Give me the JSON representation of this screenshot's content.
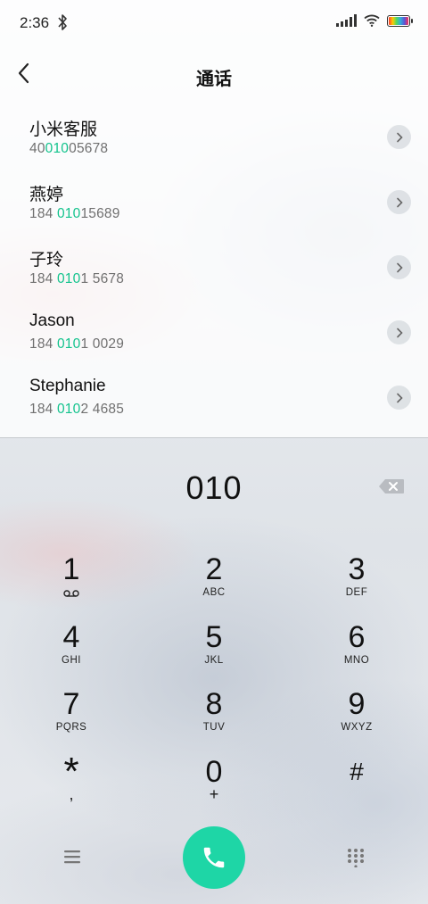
{
  "status": {
    "time": "2:36"
  },
  "header": {
    "title": "通话"
  },
  "contacts": [
    {
      "name": "小米客服",
      "num_pre": "40",
      "num_hl": "010",
      "num_post": "05678"
    },
    {
      "name": "燕婷",
      "num_pre": "184 ",
      "num_hl": "010",
      "num_post": "15689"
    },
    {
      "name": "子玲",
      "num_pre": "184 ",
      "num_hl": "010",
      "num_post": "1 5678"
    },
    {
      "name": "Jason",
      "num_pre": "184 ",
      "num_hl": "010",
      "num_post": "1 0029"
    },
    {
      "name": "Stephanie",
      "num_pre": "184 ",
      "num_hl": "010",
      "num_post": "2 4685"
    }
  ],
  "dialer": {
    "number": "010"
  },
  "keypad": [
    {
      "digit": "1",
      "letters": ""
    },
    {
      "digit": "2",
      "letters": "ABC"
    },
    {
      "digit": "3",
      "letters": "DEF"
    },
    {
      "digit": "4",
      "letters": "GHI"
    },
    {
      "digit": "5",
      "letters": "JKL"
    },
    {
      "digit": "6",
      "letters": "MNO"
    },
    {
      "digit": "7",
      "letters": "PQRS"
    },
    {
      "digit": "8",
      "letters": "TUV"
    },
    {
      "digit": "9",
      "letters": "WXYZ"
    },
    {
      "digit": "*",
      "letters": ","
    },
    {
      "digit": "0",
      "letters": "+"
    },
    {
      "digit": "#",
      "letters": ""
    }
  ],
  "colors": {
    "highlight": "#13c38d",
    "call_button": "#1ed6a6"
  },
  "icons": {
    "back": "chevron-left-icon",
    "arrow": "chevron-right-icon",
    "backspace": "backspace-icon",
    "voicemail": "voicemail-icon",
    "menu": "menu-icon",
    "call": "phone-icon",
    "keypad_toggle": "dialpad-icon"
  }
}
